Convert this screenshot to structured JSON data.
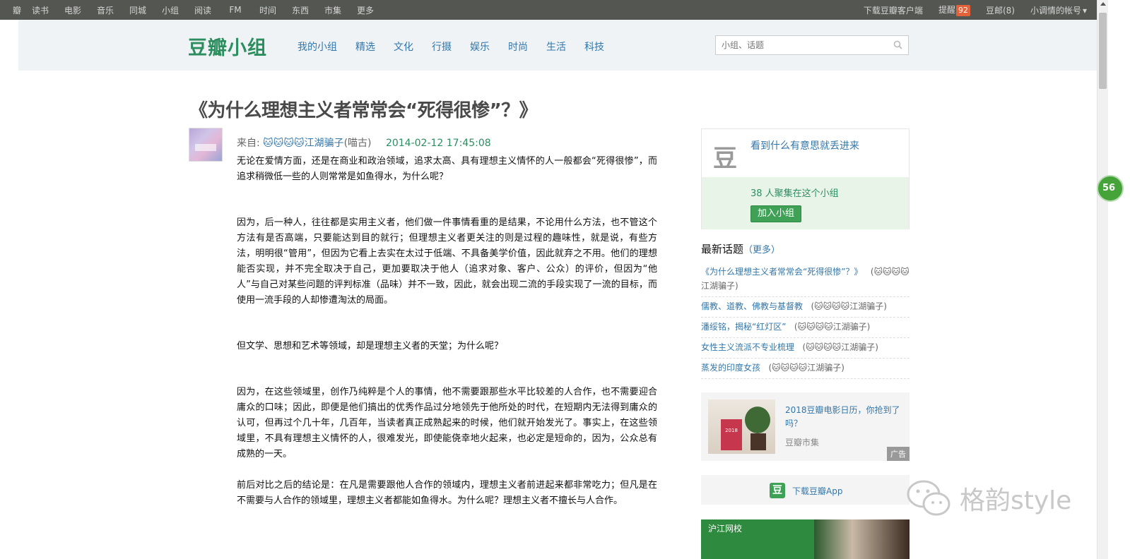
{
  "topbar": {
    "nav": [
      "瓣",
      "读书",
      "电影",
      "音乐",
      "同城",
      "小组",
      "阅读",
      "FM",
      "时间",
      "东西",
      "市集",
      "更多"
    ],
    "right": {
      "download": "下载豆瓣客户端",
      "reminder": "提醒",
      "reminder_count": "92",
      "mail": "豆邮(8)",
      "account": "小调情的帐号",
      "account_arrow": "▾"
    }
  },
  "header": {
    "logo": "豆瓣小组",
    "nav": [
      "我的小组",
      "精选",
      "文化",
      "行摄",
      "娱乐",
      "时尚",
      "生活",
      "科技"
    ],
    "search_placeholder": "小组、话题"
  },
  "article": {
    "title": "《为什么理想主义者常常会“死得很惨”？》",
    "from_label": "来自: ",
    "author": "🐱🐱🐱🐱江湖骗子",
    "location": "(喵古)",
    "date": "2014-02-12 17:45:08",
    "paragraphs": [
      "无论在爱情方面，还是在商业和政治领域，追求太高、具有理想主义情怀的人一般都会“死得很惨”，而追求稍微低一些的人则常常是如鱼得水，为什么呢？",
      "因为，后一种人，往往都是实用主义者，他们做一件事情看重的是结果，不论用什么方法，也不管这个方法有是否高端，只要能达到目的就行；但理想主义者更关注的则是过程的趣味性，就是说，有些方法，明明很“管用”，但因为它看上去实在太过于低端、不具备美学价值，因此就弃之不用。他们的理想能否实现，并不完全取决于自己，更加要取决于他人（追求对象、客户、公众）的评价，但因为“他人”与自己对某些问题的评判标准（品味）并不一致，因此，就会出现二流的手段实现了一流的目标，而使用一流手段的人却惨遭淘汰的局面。",
      "但文学、思想和艺术等领域，却是理想主义者的天堂；为什么呢？",
      "因为，在这些领域里，创作乃纯粹是个人的事情，他不需要跟那些水平比较差的人合作，也不需要迎合庸众的口味；因此，即便是他们搞出的优秀作品过分地领先于他所处的时代，在短期内无法得到庸众的认可，但再过个几十年，几百年，当读者真正成熟起来的时候，他们就开始发光了。事实上，在这些领域里，不具有理想主义情怀的人，很难发光，即使能侥幸地火起来，也必定是短命的，因为，公众总有成熟的一天。",
      "前后对比之后的结论是：在凡是需要跟他人合作的领域内，理想主义者前进起来都非常吃力；但凡是在不需要与人合作的领域里，理想主义者都能如鱼得水。为什么呢？理想主义者不擅长与人合作。"
    ]
  },
  "sidebar": {
    "dou_icon": "豆",
    "promo_link": "看到什么有意思就丢进来",
    "members": "38 人聚集在这个小组",
    "join_button": "加入小组",
    "latest_heading": "最新话题",
    "more_link": "（更多）",
    "topics": [
      {
        "title": "《为什么理想主义者常常会“死得很惨”？》",
        "author": "(🐱🐱🐱🐱江湖骗子)"
      },
      {
        "title": "儒教、道教、佛教与基督教",
        "author": "(🐱🐱🐱🐱江湖骗子)"
      },
      {
        "title": "潘绥铭，揭秘“红灯区”",
        "author": "(🐱🐱🐱🐱江湖骗子)"
      },
      {
        "title": "女性主义流派不专业梳理",
        "author": "(🐱🐱🐱🐱江湖骗子)"
      },
      {
        "title": "蒸发的印度女孩",
        "author": "(🐱🐱🐱🐱江湖骗子)"
      }
    ],
    "ad": {
      "title": "2018豆瓣电影日历，你抢到了吗？",
      "source": "豆瓣市集",
      "tag": "广告",
      "calendar_year": "2018"
    },
    "app": {
      "icon": "豆",
      "text": "下载豆瓣App"
    },
    "banner_logo": "沪江网校"
  },
  "floating_badge": "56",
  "watermark": "格韵style"
}
